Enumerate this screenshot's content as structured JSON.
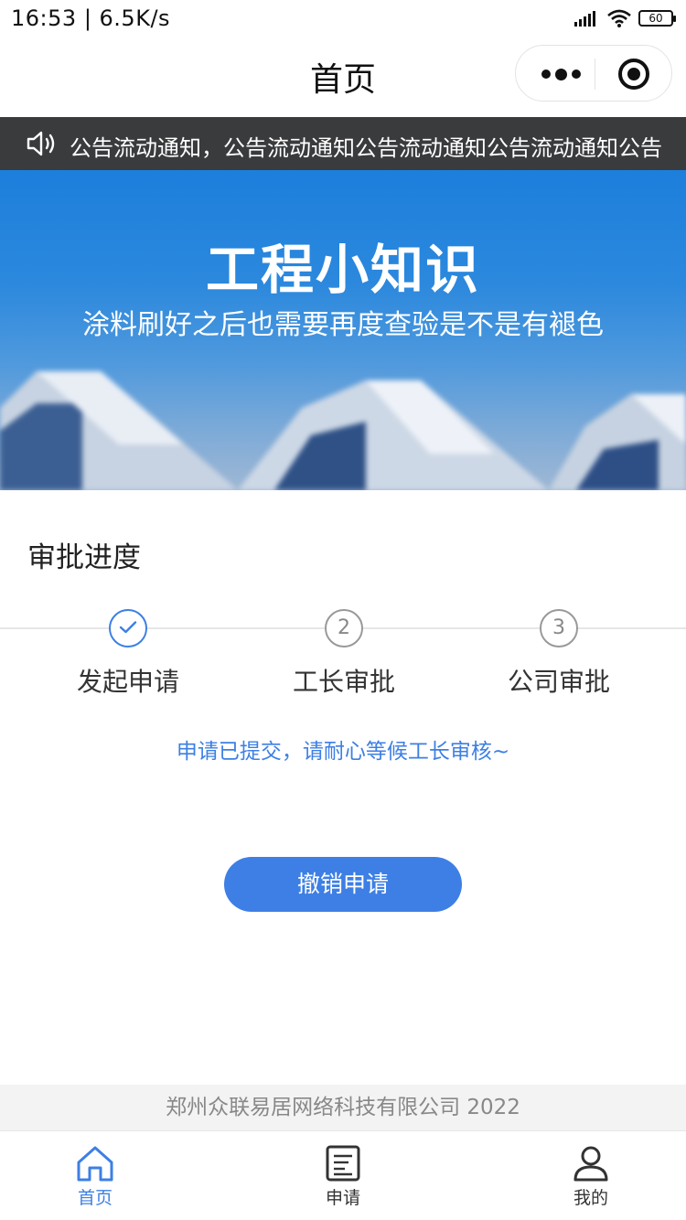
{
  "status_bar": {
    "time": "16:53",
    "speed": "6.5K/s",
    "battery": "60"
  },
  "nav": {
    "title": "首页"
  },
  "notice": {
    "text": "公告流动通知，公告流动通知公告流动通知公告流动通知公告"
  },
  "banner": {
    "title": "工程小知识",
    "subtitle": "涂料刷好之后也需要再度查验是不是有褪色"
  },
  "progress": {
    "title": "审批进度",
    "steps": [
      {
        "number": "",
        "label": "发起申请",
        "status": "done"
      },
      {
        "number": "2",
        "label": "工长审批",
        "status": "pending"
      },
      {
        "number": "3",
        "label": "公司审批",
        "status": "pending"
      }
    ],
    "message": "申请已提交，请耐心等候工长审核~",
    "cancel_label": "撤销申请"
  },
  "footer": {
    "copyright": "郑州众联易居网络科技有限公司 2022"
  },
  "tabbar": {
    "items": [
      {
        "label": "首页",
        "icon": "home-icon",
        "active": true
      },
      {
        "label": "申请",
        "icon": "document-icon",
        "active": false
      },
      {
        "label": "我的",
        "icon": "user-icon",
        "active": false
      }
    ]
  },
  "colors": {
    "accent": "#3d7fe4",
    "notice_bg": "#3a3b3d",
    "banner_top": "#1d7fdc"
  }
}
